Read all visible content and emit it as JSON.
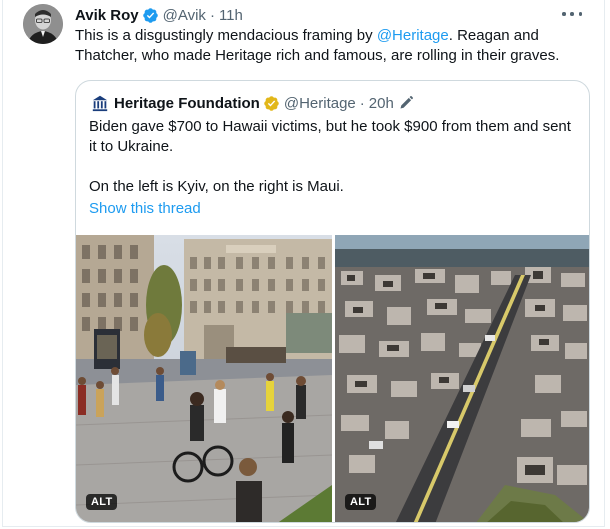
{
  "tweet": {
    "author_name": "Avik Roy",
    "handle": "@Avik",
    "separator": "·",
    "time": "11h",
    "text_before": "This is a disgustingly mendacious framing by ",
    "text_mention": "@Heritage",
    "text_after": ". Reagan and Thatcher, who made Heritage rich and famous, are rolling in their graves."
  },
  "quote": {
    "author_name": "Heritage Foundation",
    "handle": "@Heritage",
    "separator": "·",
    "time": "20h",
    "text_line1": "Biden gave $700 to Hawaii victims, but he took $900 from them and sent it to Ukraine.",
    "text_line2": "On the left is Kyiv, on the right is Maui.",
    "show_thread": "Show this thread",
    "images": [
      {
        "alt_label": "ALT"
      },
      {
        "alt_label": "ALT"
      }
    ]
  },
  "colors": {
    "accent": "#1d9bf0",
    "verified_blue": "#1d9bf0",
    "verified_gold": "#e2b719",
    "secondary_text": "#536471",
    "heritage_blue": "#1a3d7c"
  }
}
